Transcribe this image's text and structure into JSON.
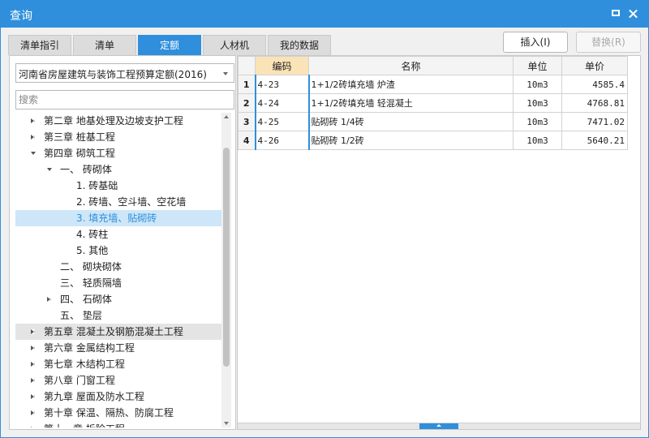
{
  "window": {
    "title": "查询"
  },
  "tabs": [
    {
      "label": "清单指引"
    },
    {
      "label": "清单"
    },
    {
      "label": "定额"
    },
    {
      "label": "人材机"
    },
    {
      "label": "我的数据"
    }
  ],
  "buttons": {
    "insert": "插入(I)",
    "replace": "替换(R)"
  },
  "library": {
    "selected": "河南省房屋建筑与装饰工程预算定额(2016)"
  },
  "search": {
    "placeholder": "搜索"
  },
  "tree": [
    {
      "label": "第二章  地基处理及边坡支护工程",
      "state": "collapsed"
    },
    {
      "label": "第三章  桩基工程",
      "state": "collapsed"
    },
    {
      "label": "第四章  砌筑工程",
      "state": "expanded"
    },
    {
      "label": "一、  砖砌体",
      "state": "expanded"
    },
    {
      "label": "1. 砖基础",
      "state": "leaf"
    },
    {
      "label": "2. 砖墙、空斗墙、空花墙",
      "state": "leaf"
    },
    {
      "label": "3. 填充墙、贴砌砖",
      "state": "leaf",
      "selected": true
    },
    {
      "label": "4. 砖柱",
      "state": "leaf"
    },
    {
      "label": "5. 其他",
      "state": "leaf"
    },
    {
      "label": "二、  砌块砌体",
      "state": "leaf"
    },
    {
      "label": "三、  轻质隔墙",
      "state": "leaf"
    },
    {
      "label": "四、  石砌体",
      "state": "collapsed"
    },
    {
      "label": "五、  垫层",
      "state": "leaf"
    },
    {
      "label": "第五章  混凝土及钢筋混凝土工程",
      "state": "collapsed",
      "hover": true
    },
    {
      "label": "第六章  金属结构工程",
      "state": "collapsed"
    },
    {
      "label": "第七章  木结构工程",
      "state": "collapsed"
    },
    {
      "label": "第八章  门窗工程",
      "state": "collapsed"
    },
    {
      "label": "第九章  屋面及防水工程",
      "state": "collapsed"
    },
    {
      "label": "第十章  保温、隔热、防腐工程",
      "state": "collapsed"
    },
    {
      "label": "第十一章  拆除工程",
      "state": "collapsed"
    }
  ],
  "table": {
    "headers": {
      "code": "编码",
      "name": "名称",
      "unit": "单位",
      "price": "单价"
    },
    "rows": [
      {
        "no": "1",
        "code": "4-23",
        "name": "1+1/2砖填充墙 炉渣",
        "unit": "10m3",
        "price": "4585.4"
      },
      {
        "no": "2",
        "code": "4-24",
        "name": "1+1/2砖填充墙 轻混凝土",
        "unit": "10m3",
        "price": "4768.81"
      },
      {
        "no": "3",
        "code": "4-25",
        "name": "贴砌砖 1/4砖",
        "unit": "10m3",
        "price": "7471.02"
      },
      {
        "no": "4",
        "code": "4-26",
        "name": "贴砌砖 1/2砖",
        "unit": "10m3",
        "price": "5640.21"
      }
    ]
  }
}
